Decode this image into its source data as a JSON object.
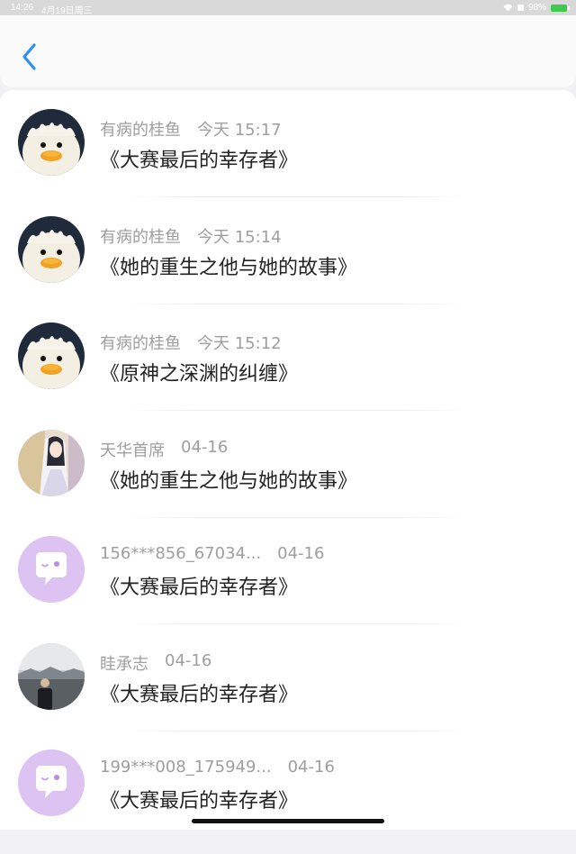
{
  "status_bar": {
    "time": "14:26",
    "date": "4月19日周三",
    "battery": "98%"
  },
  "nav": {
    "back_icon": "chevron-left-icon"
  },
  "messages": [
    {
      "name": "有病的桂鱼",
      "time": "今天 15:17",
      "title": "《大赛最后的幸存者》",
      "avatar": "duck"
    },
    {
      "name": "有病的桂鱼",
      "time": "今天 15:14",
      "title": "《她的重生之他与她的故事》",
      "avatar": "duck"
    },
    {
      "name": "有病的桂鱼",
      "time": "今天 15:12",
      "title": "《原神之深渊的纠缠》",
      "avatar": "duck"
    },
    {
      "name": "天华首席",
      "time": "04-16",
      "title": "《她的重生之他与她的故事》",
      "avatar": "character"
    },
    {
      "name": "156***856_67034...",
      "time": "04-16",
      "title": "《大赛最后的幸存者》",
      "avatar": "default-chat"
    },
    {
      "name": "眭承志",
      "time": "04-16",
      "title": "《大赛最后的幸存者》",
      "avatar": "photo"
    },
    {
      "name": "199***008_175949...",
      "time": "04-16",
      "title": "《大赛最后的幸存者》",
      "avatar": "default-chat"
    }
  ],
  "colors": {
    "accent": "#2f8ff0",
    "default_avatar_bg": "#dcc3f2"
  }
}
